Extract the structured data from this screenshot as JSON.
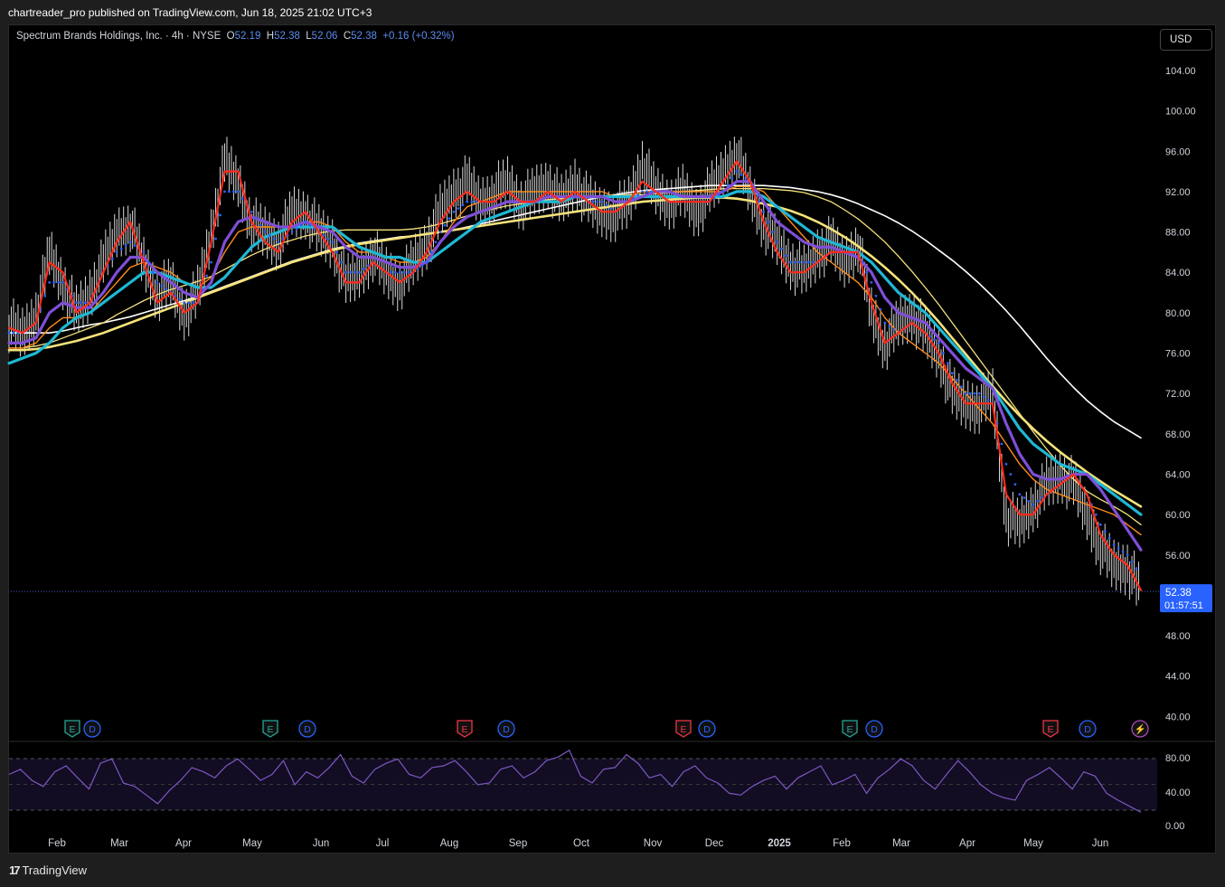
{
  "caption": "chartreader_pro published on TradingView.com, Jun 18, 2025 21:02 UTC+3",
  "legend": {
    "symbol": "Spectrum Brands Holdings, Inc. · 4h · NYSE",
    "o_label": "O",
    "o": "52.19",
    "h_label": "H",
    "h": "52.38",
    "l_label": "L",
    "l": "52.06",
    "c_label": "C",
    "c": "52.38",
    "change": "+0.16 (+0.32%)"
  },
  "currency": "USD",
  "brand": "TradingView",
  "colors": {
    "price_bars": "#ffffff",
    "fast_ma": "#ff2a1a",
    "blue_dots": "#2962ff",
    "purple_ma": "#7e4fd6",
    "cyan_ma": "#1fb8d4",
    "orange_ma": "#ff8c1a",
    "yellow_ma": "#f5e27a",
    "white_ma": "#ffffff",
    "rsi": "#7e57c2",
    "price_tag": "#2962ff"
  },
  "chart_data": {
    "type": "line",
    "title": "Spectrum Brands Holdings, Inc. · 4h · NYSE",
    "xlabel": "",
    "ylabel": "",
    "x_ticks": [
      "Feb",
      "Mar",
      "Apr",
      "May",
      "Jun",
      "Jul",
      "Aug",
      "Sep",
      "Oct",
      "Nov",
      "Dec",
      "2025",
      "Feb",
      "Mar",
      "Apr",
      "May",
      "Jun"
    ],
    "y_ticks": [
      "104.00",
      "100.00",
      "96.00",
      "92.00",
      "88.00",
      "84.00",
      "80.00",
      "76.00",
      "72.00",
      "68.00",
      "64.00",
      "60.00",
      "56.00",
      "52.00",
      "48.00",
      "44.00",
      "40.00"
    ],
    "ylim": [
      38.6,
      107.4
    ],
    "grid": false,
    "last_price": "52.38",
    "countdown": "01:57:51",
    "series": [
      {
        "role": "price",
        "values": [
          79,
          78,
          80,
          86,
          83,
          80,
          82,
          85,
          88,
          89,
          85,
          82,
          83,
          80,
          82,
          88,
          95,
          93,
          89,
          88,
          87,
          90,
          90,
          88,
          87,
          83,
          84,
          86,
          84,
          83,
          85,
          87,
          90,
          92,
          93,
          91,
          92,
          93,
          91,
          92,
          93,
          91,
          93,
          91,
          90,
          90,
          91,
          95,
          92,
          91,
          92,
          90,
          92,
          94,
          96,
          92,
          89,
          87,
          85,
          84,
          86,
          87,
          85,
          87,
          80,
          77,
          79,
          80,
          78,
          76,
          72,
          71,
          71,
          72,
          60,
          59,
          61,
          63,
          64,
          63,
          60,
          57,
          55,
          55,
          52.38
        ]
      },
      {
        "role": "fast_ma",
        "values": [
          78.5,
          78,
          79,
          85,
          84,
          80,
          81,
          84,
          87,
          89,
          85,
          81,
          82,
          80,
          81,
          87,
          94,
          94,
          89,
          87,
          86,
          89,
          90,
          88,
          86,
          83,
          83,
          85,
          84,
          83,
          84,
          86,
          89,
          91,
          92,
          91,
          91,
          92,
          91,
          91,
          92,
          91,
          92,
          91,
          90,
          90,
          91,
          93,
          92,
          91,
          91,
          91,
          91,
          93,
          95,
          93,
          89,
          86,
          84,
          84,
          85,
          86,
          86,
          86,
          81,
          77,
          78,
          79,
          78,
          76,
          73,
          71,
          71,
          71,
          62,
          60,
          60,
          62,
          63,
          64,
          62,
          58,
          56,
          55,
          52.5
        ]
      },
      {
        "role": "blue_dots",
        "values": [
          78,
          78,
          79,
          83,
          83,
          81,
          81,
          84,
          86,
          87,
          86,
          83,
          82,
          81,
          81,
          85,
          92,
          92,
          90,
          88,
          87,
          88,
          89,
          88,
          87,
          84,
          84,
          85,
          84,
          84,
          84,
          85,
          88,
          90,
          91,
          91,
          91,
          92,
          91,
          91,
          92,
          91,
          92,
          91,
          91,
          90,
          91,
          92,
          92,
          91,
          91,
          91,
          91,
          92,
          94,
          93,
          90,
          87,
          85,
          85,
          85,
          86,
          86,
          86,
          83,
          79,
          78,
          79,
          78,
          77,
          74,
          72,
          72,
          71,
          65,
          62,
          61,
          62,
          63,
          64,
          62,
          59,
          57,
          56,
          54
        ]
      },
      {
        "role": "purple_ma",
        "values": [
          77,
          77,
          77.5,
          80,
          81,
          80.5,
          80.5,
          82,
          84,
          85.5,
          85.5,
          84,
          83,
          82,
          81.5,
          83,
          87,
          89,
          89.5,
          89,
          88.5,
          88.5,
          89,
          88.5,
          88,
          86.5,
          85.5,
          85.5,
          85,
          84.5,
          84.5,
          85,
          87,
          88.5,
          89.5,
          90,
          90.5,
          91,
          91,
          91,
          91.5,
          91.5,
          91.5,
          91.5,
          91.5,
          91,
          91,
          91.5,
          92,
          92,
          91.5,
          91.5,
          91.5,
          92,
          93,
          93,
          91,
          89,
          88,
          87,
          86.5,
          86.5,
          86,
          85.5,
          84,
          81.5,
          80,
          79.5,
          79,
          77.5,
          76,
          74.5,
          73.5,
          72.5,
          69,
          66,
          64,
          63.5,
          63.5,
          64,
          64,
          62.5,
          60.5,
          58.5,
          56.5
        ]
      },
      {
        "role": "cyan_ma",
        "values": [
          75,
          75.5,
          76,
          77,
          78.5,
          79.5,
          80,
          81,
          82,
          83,
          84,
          84,
          83.5,
          83,
          82.5,
          82.5,
          83.5,
          85,
          86.5,
          87.5,
          88,
          88.5,
          88.5,
          88.5,
          88.5,
          87.5,
          86.5,
          86,
          85.5,
          85.5,
          85,
          85,
          86,
          87,
          88,
          89,
          89.5,
          90,
          90.5,
          91,
          91,
          91,
          91.5,
          91.5,
          91.5,
          91.5,
          91.5,
          91.5,
          91.5,
          91.5,
          91.5,
          91.5,
          91.5,
          91.5,
          92,
          92,
          91.5,
          90.5,
          89.5,
          88.5,
          87.5,
          87,
          86.5,
          86,
          85,
          83.5,
          82,
          81,
          80,
          78.5,
          77,
          75.5,
          74,
          72.5,
          70.5,
          68.5,
          67,
          66,
          65,
          64.5,
          64,
          63,
          62,
          61,
          60
        ]
      },
      {
        "role": "orange_ma",
        "values": [
          76.5,
          76.5,
          77,
          78.5,
          79.5,
          79.5,
          80,
          81.5,
          83,
          84.5,
          85,
          84.5,
          84,
          83,
          82.5,
          83.5,
          86,
          88,
          88.5,
          88.5,
          88.5,
          88.5,
          89,
          89,
          88.5,
          87,
          86,
          86,
          85.5,
          85,
          85,
          85.5,
          87,
          89,
          90.5,
          91,
          91.5,
          92,
          92,
          92,
          92,
          92,
          92,
          92,
          92,
          91.5,
          91.5,
          92,
          92,
          92,
          92,
          92,
          92,
          92,
          92.5,
          92.5,
          92,
          90.5,
          89,
          87.5,
          86,
          85,
          84,
          83,
          81.5,
          79.5,
          78,
          77,
          76,
          75,
          73.5,
          72,
          70.5,
          69,
          67,
          65,
          63.5,
          62.5,
          62,
          61.5,
          61,
          60.5,
          60,
          59,
          58
        ]
      },
      {
        "role": "yellow_ma",
        "values": [
          76.5,
          76.5,
          76.7,
          77,
          77.5,
          78,
          78.5,
          79,
          79.8,
          80.5,
          81.2,
          81.8,
          82.3,
          82.7,
          83.1,
          83.6,
          84.3,
          85,
          85.7,
          86.3,
          86.8,
          87.2,
          87.6,
          87.9,
          88.1,
          88.2,
          88.2,
          88.2,
          88.2,
          88.2,
          88.3,
          88.5,
          88.8,
          89.2,
          89.6,
          90,
          90.3,
          90.6,
          90.8,
          91,
          91.2,
          91.3,
          91.4,
          91.5,
          91.6,
          91.6,
          91.7,
          91.7,
          91.8,
          91.9,
          92,
          92.1,
          92.2,
          92.3,
          92.3,
          92.3,
          92.3,
          92.2,
          92.1,
          91.9,
          91.5,
          91,
          90.2,
          89.3,
          88.2,
          87,
          85.6,
          84.1,
          82.5,
          80.8,
          79,
          77.2,
          75.4,
          73.6,
          71.8,
          70,
          68.2,
          66.5,
          64.9,
          63.5,
          62.3,
          61.5,
          60.8,
          60,
          59
        ]
      },
      {
        "role": "white_ma",
        "values": [
          78,
          78,
          78,
          78,
          78.2,
          78.5,
          78.8,
          79,
          79.3,
          79.6,
          80,
          80.4,
          80.8,
          81.2,
          81.6,
          82.1,
          82.6,
          83.1,
          83.6,
          84.1,
          84.6,
          85.1,
          85.5,
          85.9,
          86.3,
          86.6,
          86.9,
          87.1,
          87.3,
          87.5,
          87.6,
          87.8,
          88,
          88.2,
          88.5,
          88.8,
          89.1,
          89.4,
          89.7,
          90,
          90.3,
          90.6,
          90.9,
          91.2,
          91.5,
          91.7,
          91.9,
          92.1,
          92.2,
          92.3,
          92.4,
          92.5,
          92.6,
          92.6,
          92.6,
          92.6,
          92.6,
          92.5,
          92.4,
          92.2,
          92,
          91.7,
          91.3,
          90.8,
          90.2,
          89.6,
          88.9,
          88.1,
          87.2,
          86.2,
          85.2,
          84.1,
          82.9,
          81.6,
          80.2,
          78.7,
          77.1,
          75.5,
          74,
          72.6,
          71.3,
          70.2,
          69.2,
          68.4,
          67.6
        ]
      },
      {
        "role": "yellow_long_ma",
        "values": [
          76.3,
          76.3,
          76.4,
          76.6,
          76.9,
          77.2,
          77.6,
          78,
          78.5,
          79,
          79.5,
          80,
          80.5,
          81,
          81.5,
          82,
          82.5,
          83,
          83.5,
          84,
          84.5,
          85,
          85.4,
          85.8,
          86.2,
          86.5,
          86.8,
          87,
          87.2,
          87.4,
          87.6,
          87.8,
          88,
          88.2,
          88.4,
          88.6,
          88.8,
          89,
          89.2,
          89.4,
          89.6,
          89.8,
          90,
          90.2,
          90.4,
          90.6,
          90.8,
          91,
          91.1,
          91.2,
          91.3,
          91.4,
          91.4,
          91.4,
          91.3,
          91.1,
          90.8,
          90.5,
          90.1,
          89.6,
          89,
          88.3,
          87.5,
          86.6,
          85.6,
          84.5,
          83.3,
          82,
          80.6,
          79.1,
          77.5,
          75.9,
          74.3,
          72.7,
          71.2,
          69.8,
          68.5,
          67.3,
          66.2,
          65.2,
          64.2,
          63.3,
          62.4,
          61.6,
          60.8
        ]
      }
    ],
    "rsi": {
      "levels": [
        "80.00",
        "40.00",
        "0.00"
      ],
      "upper": 70,
      "lower": 30,
      "ylim": [
        0,
        84
      ],
      "values": [
        52,
        58,
        45,
        38,
        55,
        62,
        48,
        35,
        65,
        70,
        42,
        38,
        28,
        18,
        33,
        45,
        60,
        55,
        48,
        62,
        70,
        58,
        45,
        52,
        68,
        40,
        55,
        48,
        60,
        75,
        50,
        42,
        58,
        65,
        70,
        52,
        48,
        60,
        62,
        68,
        55,
        40,
        42,
        58,
        62,
        48,
        55,
        68,
        72,
        80,
        50,
        42,
        58,
        60,
        75,
        65,
        48,
        52,
        38,
        55,
        62,
        48,
        42,
        30,
        28,
        38,
        45,
        50,
        35,
        48,
        55,
        62,
        40,
        45,
        52,
        30,
        48,
        58,
        70,
        62,
        45,
        35,
        52,
        68,
        55,
        40,
        30,
        25,
        22,
        45,
        52,
        60,
        48,
        35,
        55,
        50,
        30,
        22,
        15,
        8
      ]
    },
    "events": [
      {
        "label": "E",
        "kind": "earnings-positive"
      },
      {
        "label": "D",
        "kind": "dividend"
      },
      {
        "label": "E",
        "kind": "earnings-positive"
      },
      {
        "label": "D",
        "kind": "dividend"
      },
      {
        "label": "E",
        "kind": "earnings-negative"
      },
      {
        "label": "D",
        "kind": "dividend"
      },
      {
        "label": "E",
        "kind": "earnings-negative"
      },
      {
        "label": "D",
        "kind": "dividend"
      },
      {
        "label": "E",
        "kind": "earnings-positive"
      },
      {
        "label": "D",
        "kind": "dividend"
      },
      {
        "label": "E",
        "kind": "earnings-negative"
      },
      {
        "label": "D",
        "kind": "dividend"
      },
      {
        "label": "⚡",
        "kind": "split"
      }
    ]
  }
}
